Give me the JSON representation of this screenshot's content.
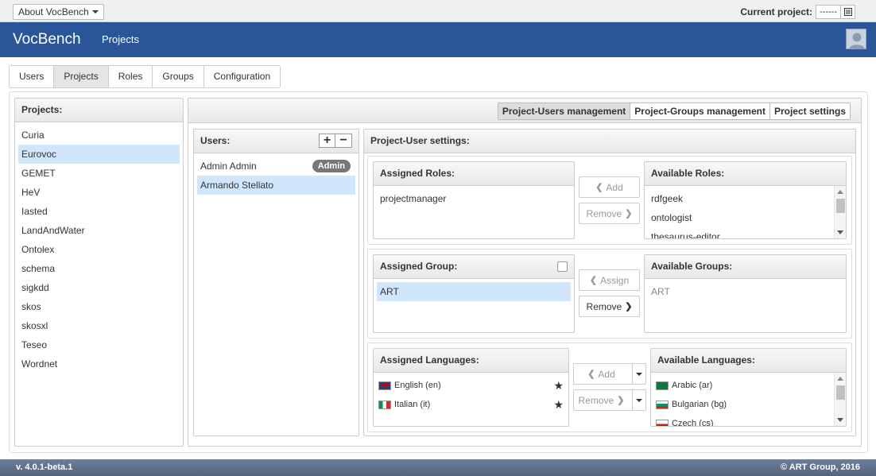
{
  "topbar": {
    "about_label": "About VocBench",
    "current_project_label": "Current project:",
    "current_project_value": "------"
  },
  "navbar": {
    "brand": "VocBench",
    "link": "Projects"
  },
  "tabs": [
    {
      "label": "Users",
      "active": false
    },
    {
      "label": "Projects",
      "active": true
    },
    {
      "label": "Roles",
      "active": false
    },
    {
      "label": "Groups",
      "active": false
    },
    {
      "label": "Configuration",
      "active": false
    }
  ],
  "projects": {
    "title": "Projects:",
    "items": [
      "Curia",
      "Eurovoc",
      "GEMET",
      "HeV",
      "Iasted",
      "LandAndWater",
      "Ontolex",
      "schema",
      "sigkdd",
      "skos",
      "skosxl",
      "Teseo",
      "Wordnet"
    ],
    "selected": "Eurovoc"
  },
  "management_tabs": [
    {
      "label": "Project-Users management",
      "active": true
    },
    {
      "label": "Project-Groups management",
      "active": false
    },
    {
      "label": "Project settings",
      "active": false
    }
  ],
  "users": {
    "title": "Users:",
    "items": [
      {
        "name": "Admin Admin",
        "badge": "Admin"
      },
      {
        "name": "Armando Stellato",
        "selected": true
      }
    ]
  },
  "settings": {
    "title": "Project-User settings:",
    "assigned_roles": {
      "title": "Assigned Roles:",
      "items": [
        "projectmanager"
      ]
    },
    "roles_add": "Add",
    "roles_remove": "Remove",
    "available_roles": {
      "title": "Available Roles:",
      "items": [
        "rdfgeek",
        "ontologist",
        "thesaurus-editor"
      ]
    },
    "assigned_group": {
      "title": "Assigned Group:",
      "items": [
        "ART"
      ]
    },
    "group_assign": "Assign",
    "group_remove": "Remove",
    "available_groups": {
      "title": "Available Groups:",
      "items": [
        "ART"
      ]
    },
    "assigned_languages": {
      "title": "Assigned Languages:",
      "items": [
        {
          "label": "English (en)",
          "flag": "gb-flag-icon"
        },
        {
          "label": "Italian (it)",
          "flag": "it-flag-icon"
        }
      ]
    },
    "lang_add": "Add",
    "lang_remove": "Remove",
    "available_languages": {
      "title": "Available Languages:",
      "items": [
        {
          "label": "Arabic (ar)",
          "flag": "sa-flag-icon"
        },
        {
          "label": "Bulgarian (bg)",
          "flag": "bg-flag-icon"
        },
        {
          "label": "Czech (cs)",
          "flag": "cz-flag-icon"
        }
      ]
    }
  },
  "footer": {
    "version": "v. 4.0.1-beta.1",
    "copyright": "© ART Group, 2016"
  },
  "colors": {
    "navbar": "#2a5699",
    "selected_row": "#cfe6fb",
    "footer": "#5e6f8c"
  }
}
